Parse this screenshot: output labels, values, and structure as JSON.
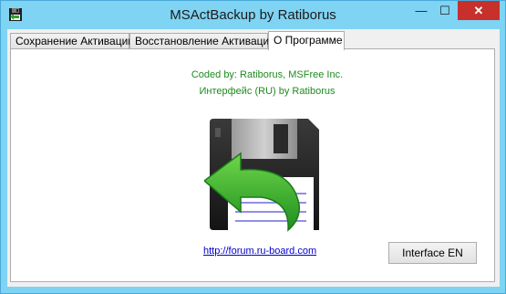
{
  "window": {
    "title": "MSActBackup by Ratiborus",
    "controls": {
      "minimize": "—",
      "maximize": "☐",
      "close": "✕"
    }
  },
  "tabs": [
    {
      "label": "Сохранение Активации",
      "active": false
    },
    {
      "label": "Восстановление Активации",
      "active": false
    },
    {
      "label": "О Программе",
      "active": true
    }
  ],
  "about": {
    "credit_line_1": "Coded by: Ratiborus, MSFree Inc.",
    "credit_line_2": "Интерфейс (RU) by Ratiborus",
    "logo_icon": "floppy-disk-restore-icon",
    "link_text": "http://forum.ru-board.com",
    "language_button": "Interface EN"
  },
  "colors": {
    "title_bar": "#7fd3f3",
    "close_button": "#c7302b",
    "credit_text": "#1f8a1f",
    "link_text": "#0000cc",
    "arrow_green": "#2fa32f"
  }
}
